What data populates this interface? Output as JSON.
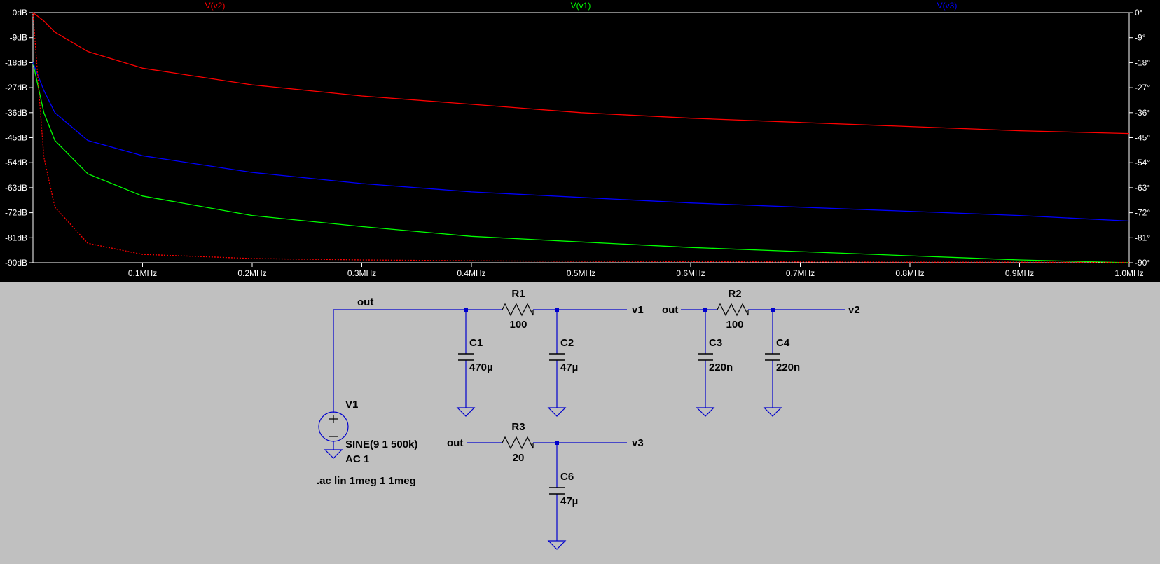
{
  "plot": {
    "traces": [
      {
        "name": "V(v2)",
        "color": "#ff0000"
      },
      {
        "name": "V(v1)",
        "color": "#00ff00"
      },
      {
        "name": "V(v3)",
        "color": "#0000ff"
      }
    ],
    "phase_color": "#ffffff",
    "tick_color": "#ffffff",
    "frame_color": "#ffffff"
  },
  "chart_data": {
    "type": "line",
    "title": "",
    "xlabel": "",
    "ylabel": "",
    "x_range": [
      0,
      1.0
    ],
    "x_unit": "MHz",
    "y_range": [
      -90,
      0
    ],
    "y_unit": "dB",
    "y2_range": [
      -90,
      0
    ],
    "y2_unit": "°",
    "grid": false,
    "x_ticks": [
      "0.1MHz",
      "0.2MHz",
      "0.3MHz",
      "0.4MHz",
      "0.5MHz",
      "0.6MHz",
      "0.7MHz",
      "0.8MHz",
      "0.9MHz",
      "1.0MHz"
    ],
    "y_ticks": [
      "0dB",
      "-9dB",
      "-18dB",
      "-27dB",
      "-36dB",
      "-45dB",
      "-54dB",
      "-63dB",
      "-72dB",
      "-81dB",
      "-90dB"
    ],
    "y2_ticks": [
      "0°",
      "-9°",
      "-18°",
      "-27°",
      "-36°",
      "-45°",
      "-54°",
      "-63°",
      "-72°",
      "-81°",
      "-90°"
    ],
    "x": [
      0.0,
      0.01,
      0.02,
      0.05,
      0.1,
      0.2,
      0.3,
      0.4,
      0.5,
      0.6,
      0.7,
      0.8,
      0.9,
      1.0
    ],
    "series": [
      {
        "name": "V(v2)",
        "style": "magnitude",
        "color": "#ff0000",
        "values": [
          0,
          -3,
          -7,
          -14,
          -20,
          -26,
          -30,
          -33,
          -36,
          -38,
          -39.5,
          -41,
          -42.5,
          -43.5
        ]
      },
      {
        "name": "V(v1)",
        "style": "magnitude",
        "color": "#00ff00",
        "values": [
          -18,
          -36,
          -46,
          -58,
          -66,
          -73,
          -77,
          -80.5,
          -82.5,
          -84.5,
          -86,
          -87.5,
          -89,
          -90
        ]
      },
      {
        "name": "V(v3)",
        "style": "magnitude",
        "color": "#0000ff",
        "values": [
          -18,
          -28,
          -36,
          -46,
          -51.5,
          -57.5,
          -61.5,
          -64.5,
          -66.5,
          -68.5,
          -70,
          -71.5,
          -73,
          -75
        ]
      },
      {
        "name": "V(v2)",
        "style": "phase",
        "color": "#ff0000",
        "values": [
          0,
          -52,
          -70,
          -83,
          -87,
          -88.5,
          -89,
          -89.3,
          -89.5,
          -89.6,
          -89.7,
          -89.8,
          -89.8,
          -89.9
        ]
      }
    ]
  },
  "schematic": {
    "labels": {
      "out_top": "out",
      "v1": "v1",
      "out_right": "out",
      "v2": "v2",
      "out_bottom": "out",
      "v3": "v3"
    },
    "components": {
      "R1": {
        "name": "R1",
        "value": "100"
      },
      "R2": {
        "name": "R2",
        "value": "100"
      },
      "R3": {
        "name": "R3",
        "value": "20"
      },
      "C1": {
        "name": "C1",
        "value": "470µ"
      },
      "C2": {
        "name": "C2",
        "value": "47µ"
      },
      "C3": {
        "name": "C3",
        "value": "220n"
      },
      "C4": {
        "name": "C4",
        "value": "220n"
      },
      "C6": {
        "name": "C6",
        "value": "47µ"
      },
      "V1": {
        "name": "V1",
        "value": "SINE(9 1 500k)",
        "ac": "AC 1"
      }
    },
    "directive": ".ac lin 1meg 1 1meg",
    "wire_color": "#0000cd"
  }
}
